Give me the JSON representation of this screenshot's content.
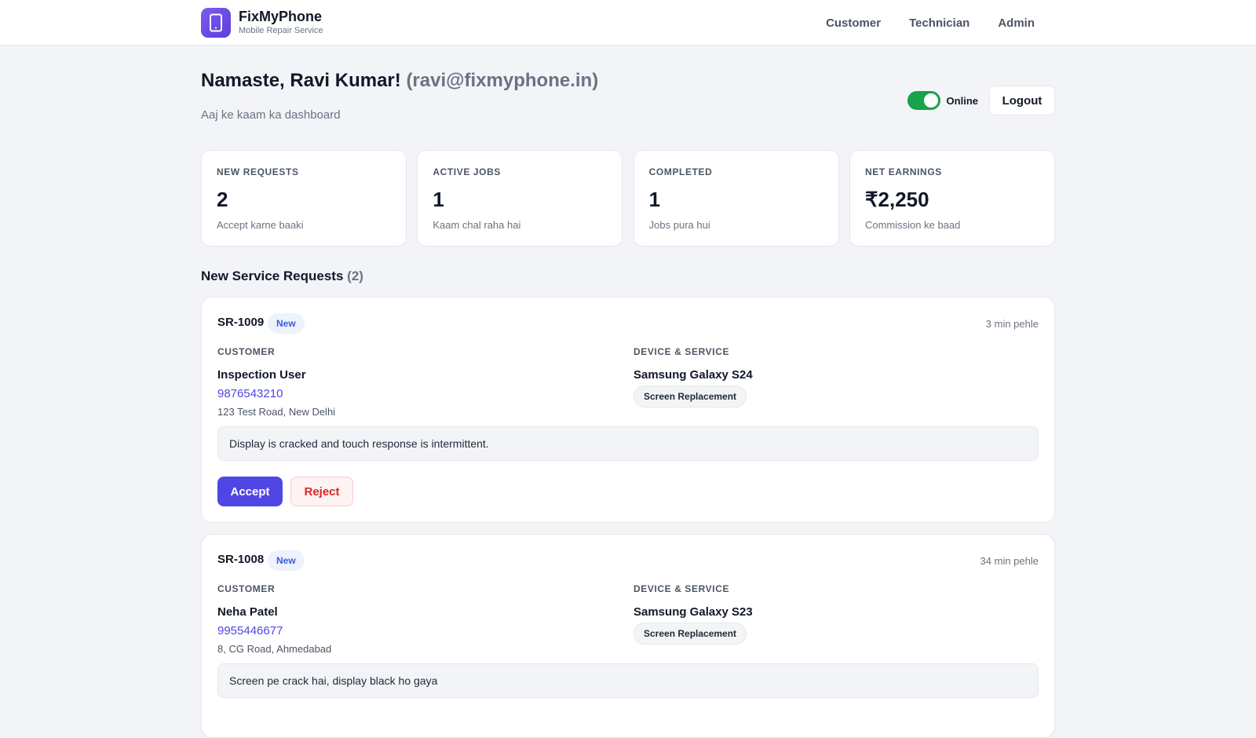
{
  "brand": {
    "name": "FixMyPhone",
    "tagline": "Mobile Repair Service",
    "icon": "phone-icon",
    "accent": "#6a4ce6"
  },
  "nav": {
    "items": [
      "Customer",
      "Technician",
      "Admin"
    ]
  },
  "greeting": {
    "title": "Namaste, Ravi Kumar!",
    "email": "(ravi@fixmyphone.in)",
    "subtitle": "Aaj ke kaam ka dashboard"
  },
  "status": {
    "label": "Online",
    "on": true,
    "logout_label": "Logout"
  },
  "stats": [
    {
      "label": "NEW REQUESTS",
      "value": "2",
      "note": "Accept karne baaki"
    },
    {
      "label": "ACTIVE JOBS",
      "value": "1",
      "note": "Kaam chal raha hai"
    },
    {
      "label": "COMPLETED",
      "value": "1",
      "note": "Jobs pura hui"
    },
    {
      "label": "NET EARNINGS",
      "value": "₹2,250",
      "note": "Commission ke baad"
    }
  ],
  "section": {
    "title": "New Service Requests",
    "count": "(2)"
  },
  "labels": {
    "customer": "CUSTOMER",
    "device_service": "DEVICE & SERVICE",
    "accept": "Accept",
    "reject": "Reject"
  },
  "requests": [
    {
      "id": "SR-1009",
      "status": "New",
      "time": "3 min pehle",
      "customer_name": "Inspection User",
      "phone": "9876543210",
      "address": "123 Test Road, New Delhi",
      "device": "Samsung Galaxy S24",
      "service": "Screen Replacement",
      "issue": "Display is cracked and touch response is intermittent."
    },
    {
      "id": "SR-1008",
      "status": "New",
      "time": "34 min pehle",
      "customer_name": "Neha Patel",
      "phone": "9955446677",
      "address": "8, CG Road, Ahmedabad",
      "device": "Samsung Galaxy S23",
      "service": "Screen Replacement",
      "issue": "Screen pe crack hai, display black ho gaya"
    }
  ]
}
